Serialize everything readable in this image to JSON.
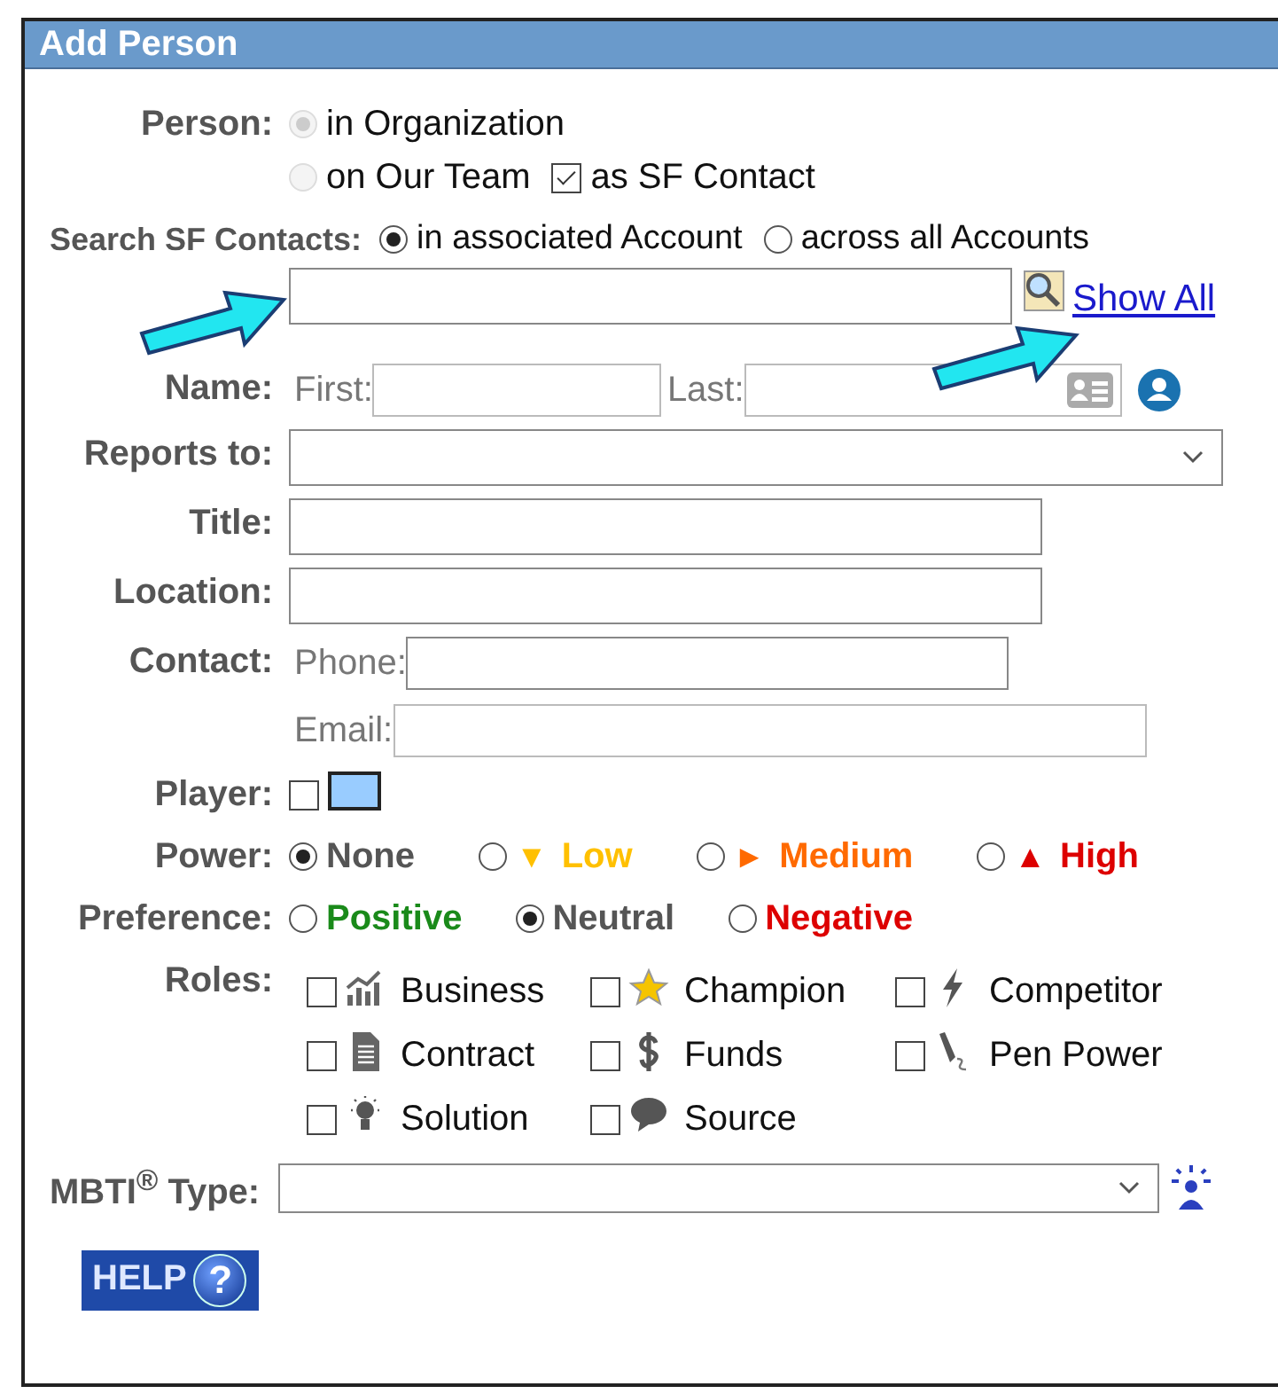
{
  "header": {
    "title": "Add Person"
  },
  "person": {
    "label": "Person:",
    "options": [
      {
        "label": "in Organization",
        "selected": true,
        "disabled": true
      },
      {
        "label": "on Our Team",
        "selected": false,
        "disabled": true
      }
    ],
    "sf_contact": {
      "label": "as SF Contact",
      "checked": true
    }
  },
  "search": {
    "label": "Search SF Contacts:",
    "scopes": [
      {
        "label": "in associated Account",
        "selected": true
      },
      {
        "label": "across all Accounts",
        "selected": false
      }
    ],
    "show_all": "Show All"
  },
  "name": {
    "label": "Name:",
    "first_label": "First:",
    "last_label": "Last:"
  },
  "reports_to": {
    "label": "Reports to:"
  },
  "title": {
    "label": "Title:"
  },
  "location": {
    "label": "Location:"
  },
  "contact": {
    "label": "Contact:",
    "phone_label": "Phone:",
    "email_label": "Email:"
  },
  "player": {
    "label": "Player:",
    "checked": false
  },
  "power": {
    "label": "Power:",
    "options": [
      {
        "label": "None",
        "color": "#555555",
        "selected": true
      },
      {
        "label": "Low",
        "symbol": "▼",
        "color": "#ffc000",
        "selected": false
      },
      {
        "label": "Medium",
        "symbol": "►",
        "color": "#ff6a00",
        "selected": false
      },
      {
        "label": "High",
        "symbol": "▲",
        "color": "#dd0000",
        "selected": false
      }
    ]
  },
  "preference": {
    "label": "Preference:",
    "options": [
      {
        "label": "Positive",
        "color": "#1a8a1a",
        "selected": false
      },
      {
        "label": "Neutral",
        "color": "#555555",
        "selected": true
      },
      {
        "label": "Negative",
        "color": "#dd0000",
        "selected": false
      }
    ]
  },
  "roles": {
    "label": "Roles:",
    "items": [
      {
        "label": "Business",
        "kind": "chart",
        "checked": false
      },
      {
        "label": "Champion",
        "kind": "star",
        "checked": false
      },
      {
        "label": "Competitor",
        "kind": "bolt",
        "checked": false
      },
      {
        "label": "Contract",
        "kind": "document",
        "checked": false
      },
      {
        "label": "Funds",
        "kind": "dollar",
        "checked": false
      },
      {
        "label": "Pen Power",
        "kind": "pen",
        "checked": false
      },
      {
        "label": "Solution",
        "kind": "bulb",
        "checked": false
      },
      {
        "label": "Source",
        "kind": "speech",
        "checked": false
      }
    ]
  },
  "mbti": {
    "label": "MBTI$^{®}$ Type:"
  },
  "help": {
    "label": "HELP",
    "symbol": "?"
  }
}
